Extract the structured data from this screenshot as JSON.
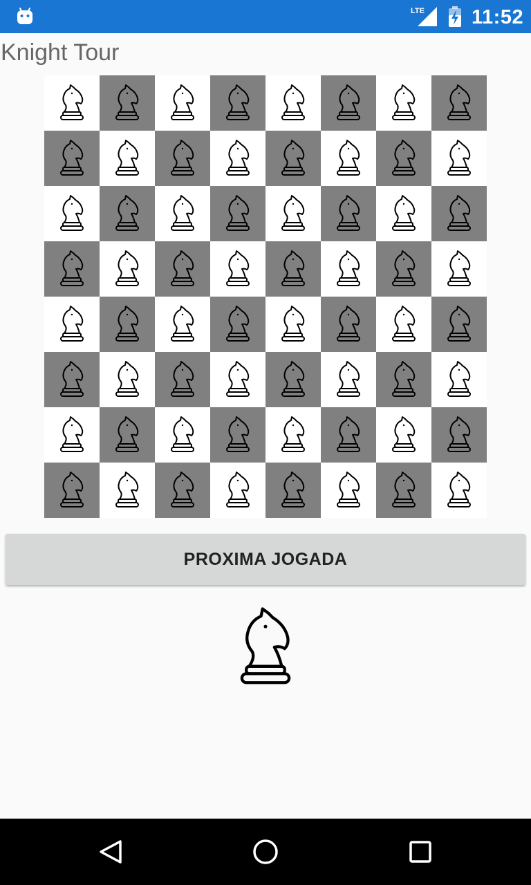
{
  "status_bar": {
    "time": "11:52",
    "network": "LTE",
    "icons": [
      "android-icon",
      "signal-icon",
      "battery-icon"
    ]
  },
  "app": {
    "title": "Knight Tour"
  },
  "board": {
    "rows": 8,
    "cols": 8,
    "piece": "knight",
    "light_color": "#ffffff",
    "dark_color": "#808080"
  },
  "next_button": {
    "label": "PROXIMA JOGADA"
  },
  "current_piece": "knight-icon",
  "nav_bar": {
    "buttons": [
      "back-icon",
      "home-icon",
      "recents-icon"
    ]
  },
  "colors": {
    "status_bar": "#1976d2",
    "background": "#fafafa",
    "button": "#d6d7d7",
    "nav_bar": "#000000"
  }
}
